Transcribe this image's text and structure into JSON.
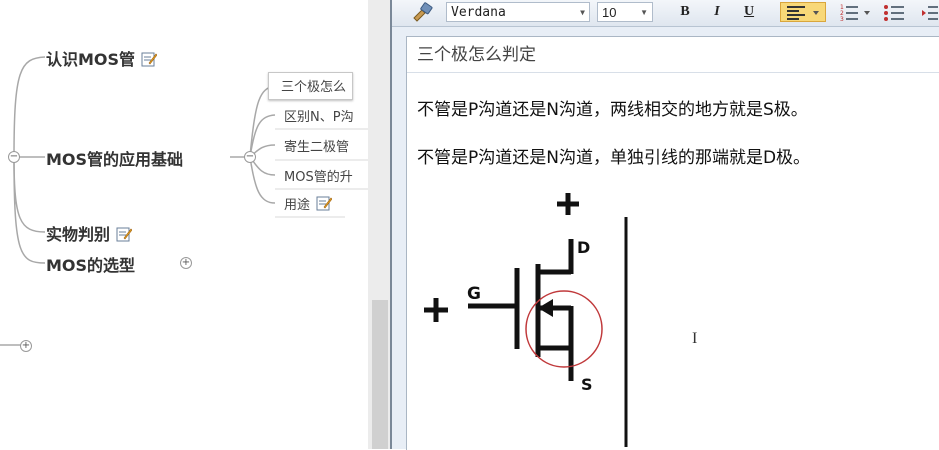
{
  "mindmap": {
    "topics": [
      {
        "label": "认识MOS管",
        "has_note": true
      },
      {
        "label": "MOS管的应用基础",
        "has_note": false
      },
      {
        "label": "实物判别",
        "has_note": true
      },
      {
        "label": "MOS的选型",
        "has_note": false
      }
    ],
    "subtopics": [
      {
        "label": "三个极怎么",
        "selected": true
      },
      {
        "label": "区别N、P沟"
      },
      {
        "label": "寄生二极管"
      },
      {
        "label": "MOS管的升"
      },
      {
        "label": "用途",
        "has_note": true
      }
    ],
    "collapse_symbol": "−",
    "expand_symbol": "+"
  },
  "toolbar": {
    "font_family": "Verdana",
    "font_size": "10",
    "bold_label": "B",
    "italic_label": "I",
    "underline_label": "U"
  },
  "note": {
    "title": "三个极怎么判定",
    "lines": [
      "不管是P沟道还是N沟道，两线相交的地方就是S极。",
      "不管是P沟道还是N沟道，单独引线的那端就是D极。"
    ],
    "diagram": {
      "plus_top": "+",
      "plus_left": "+",
      "label_g": "G",
      "label_d": "D",
      "label_s": "S"
    }
  },
  "colors": {
    "highlight_circle": "#c0393b",
    "selected_button": "#f8d878"
  }
}
